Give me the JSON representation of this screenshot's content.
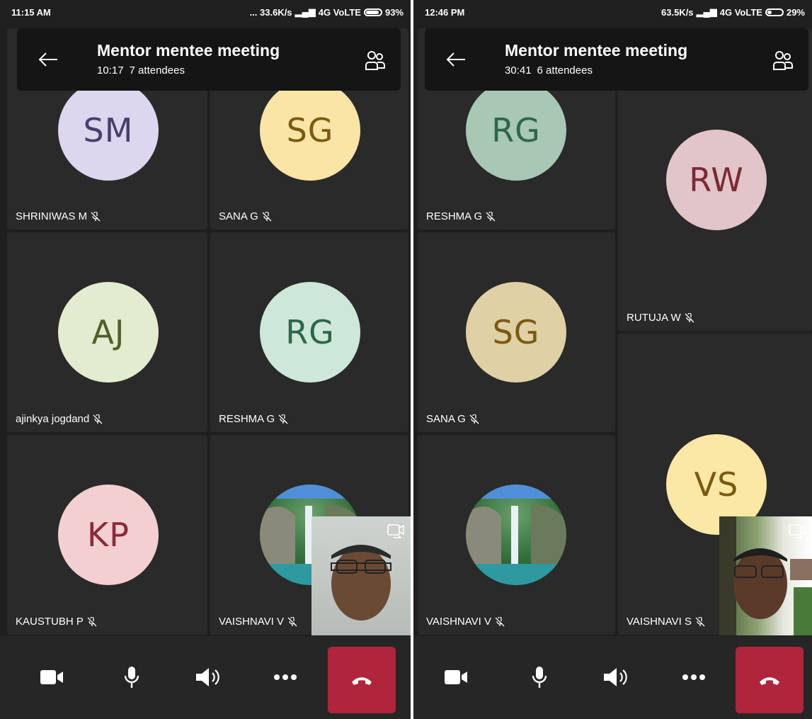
{
  "left": {
    "status": {
      "time": "11:15 AM",
      "network": "... 33.6K/s",
      "carrier": "4G VoLTE",
      "battery": "93%"
    },
    "header": {
      "title": "Mentor mentee meeting",
      "duration": "10:17",
      "attendees": "7 attendees"
    },
    "tiles": [
      {
        "name": "SHRINIWAS M",
        "initials": "SM"
      },
      {
        "name": "SANA G",
        "initials": "SG"
      },
      {
        "name": "ajinkya jogdand",
        "initials": "AJ"
      },
      {
        "name": "RESHMA G",
        "initials": "RG"
      },
      {
        "name": "KAUSTUBH P",
        "initials": "KP"
      },
      {
        "name": "VAISHNAVI V"
      }
    ]
  },
  "right": {
    "status": {
      "time": "12:46 PM",
      "network": "63.5K/s",
      "carrier": "4G VoLTE",
      "battery": "29%"
    },
    "header": {
      "title": "Mentor mentee meeting",
      "duration": "30:41",
      "attendees": "6 attendees"
    },
    "tiles": [
      {
        "name": "RESHMA G",
        "initials": "RG"
      },
      {
        "name": "RUTUJA W",
        "initials": "RW"
      },
      {
        "name": "SANA G",
        "initials": "SG"
      },
      {
        "name": "VAISHNAVI S",
        "initials": "VS"
      },
      {
        "name": "VAISHNAVI V"
      }
    ]
  },
  "colors": {
    "end_call": "#b0253b",
    "avatar_sm": "#dcd6ef",
    "avatar_sg_left": "#fbe5a6",
    "avatar_aj": "#e4ecd0",
    "avatar_rg": "#cde8d9",
    "avatar_kp": "#f3cfd2",
    "avatar_rw": "#e2c5c9",
    "avatar_sg_right": "#e0d0a6",
    "avatar_vs": "#fbe7a6"
  },
  "icons": [
    "back-arrow-icon",
    "people-icon",
    "mic-off-icon",
    "video-camera-icon",
    "microphone-icon",
    "speaker-icon",
    "more-options-icon",
    "hang-up-icon",
    "switch-camera-icon"
  ]
}
